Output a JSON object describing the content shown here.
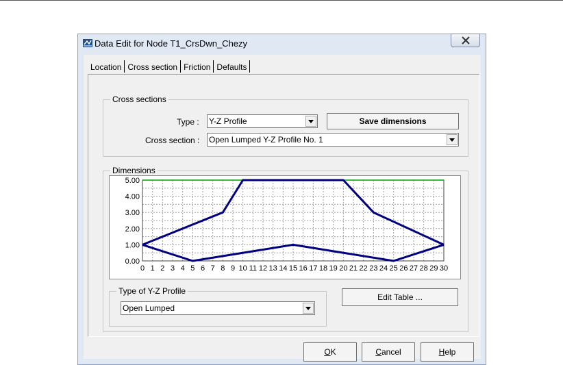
{
  "dialog": {
    "title": "Data Edit for Node T1_CrsDwn_Chezy"
  },
  "tabs": [
    {
      "label": "Location"
    },
    {
      "label": "Cross section"
    },
    {
      "label": "Friction"
    },
    {
      "label": "Defaults"
    }
  ],
  "cross_sections": {
    "group_title": "Cross sections",
    "type_label": "Type :",
    "type_value": "Y-Z Profile",
    "save_button": "Save dimensions",
    "cross_section_label": "Cross section :",
    "cross_section_value": "Open Lumped Y-Z Profile No. 1"
  },
  "dimensions": {
    "group_title": "Dimensions",
    "profile_group_title": "Type of Y-Z Profile",
    "profile_value": "Open Lumped",
    "edit_table_button": "Edit Table ..."
  },
  "footer": {
    "ok_mnemonic": "O",
    "ok_rest": "K",
    "cancel_mnemonic": "C",
    "cancel_rest": "ancel",
    "help_mnemonic": "H",
    "help_rest": "elp"
  },
  "colors": {
    "profile_line": "#000080",
    "top_line": "#00a000",
    "grid": "#a0a0a0"
  },
  "chart_data": {
    "type": "line",
    "xlim": [
      0,
      30
    ],
    "ylim": [
      0,
      5
    ],
    "x_ticks": [
      0,
      1,
      2,
      3,
      4,
      5,
      6,
      7,
      8,
      9,
      10,
      11,
      12,
      13,
      14,
      15,
      16,
      17,
      18,
      19,
      20,
      21,
      22,
      23,
      24,
      25,
      26,
      27,
      28,
      29,
      30
    ],
    "y_ticks": [
      "0.00",
      "1.00",
      "2.00",
      "3.00",
      "4.00",
      "5.00"
    ],
    "grid": true,
    "series": [
      {
        "points": [
          [
            0,
            1
          ],
          [
            5,
            0
          ],
          [
            15,
            1
          ],
          [
            25,
            0
          ],
          [
            30,
            1
          ]
        ]
      },
      {
        "points": [
          [
            0,
            1
          ],
          [
            8,
            3
          ],
          [
            10,
            5
          ],
          [
            20,
            5
          ],
          [
            23,
            3
          ],
          [
            30,
            1
          ]
        ]
      }
    ],
    "reference_line": {
      "y": 5
    }
  }
}
